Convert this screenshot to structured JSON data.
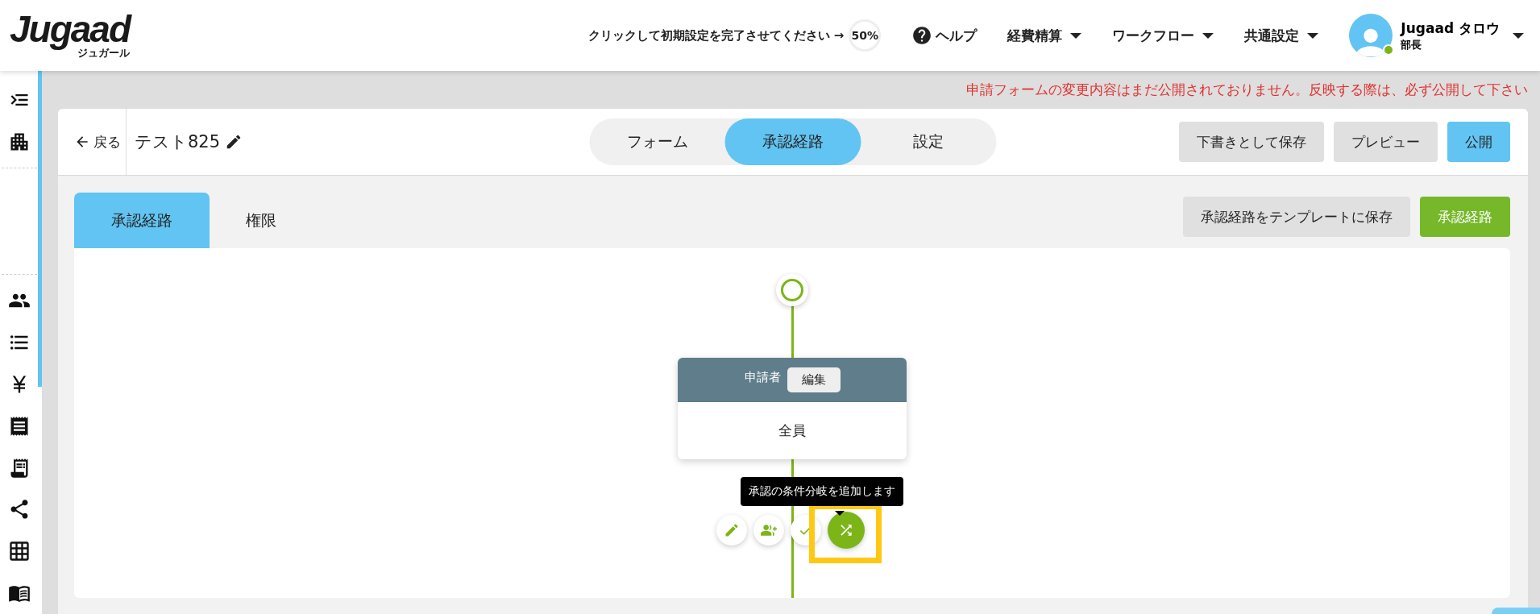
{
  "header": {
    "logo": "Jugaad",
    "logo_sub": "ジュガール",
    "setup_prompt": "クリックして初期設定を完了させてください →",
    "setup_progress": "50%",
    "help": "ヘルプ",
    "menus": [
      "経費精算",
      "ワークフロー",
      "共通設定"
    ],
    "user": {
      "name": "Jugaad タロウ",
      "role": "部長",
      "online": true
    }
  },
  "notice": "申請フォームの変更内容はまだ公開されておりません。反映する際は、必ず公開して下さい",
  "editor": {
    "back": "戻る",
    "title": "テスト825",
    "mode_tabs": [
      {
        "label": "フォーム",
        "selected": false
      },
      {
        "label": "承認経路",
        "selected": true
      },
      {
        "label": "設定",
        "selected": false
      }
    ],
    "actions": [
      {
        "label": "下書きとして保存",
        "kind": "secondary"
      },
      {
        "label": "プレビュー",
        "kind": "secondary"
      },
      {
        "label": "公開",
        "kind": "primary"
      }
    ]
  },
  "route_tabs": [
    {
      "label": "承認経路",
      "selected": true
    },
    {
      "label": "権限",
      "selected": false
    }
  ],
  "route_actions": [
    {
      "label": "承認経路をテンプレートに保存",
      "kind": "secondary"
    },
    {
      "label": "承認経路",
      "kind": "success"
    }
  ],
  "flow": {
    "node": {
      "title": "申請者",
      "edit": "編集",
      "assignee": "全員"
    },
    "tooltip": "承認の条件分岐を追加します",
    "tools": [
      {
        "kind": "edit",
        "active": false
      },
      {
        "kind": "add-user",
        "active": false
      },
      {
        "kind": "check",
        "active": false
      },
      {
        "kind": "branch",
        "active": true
      }
    ]
  }
}
